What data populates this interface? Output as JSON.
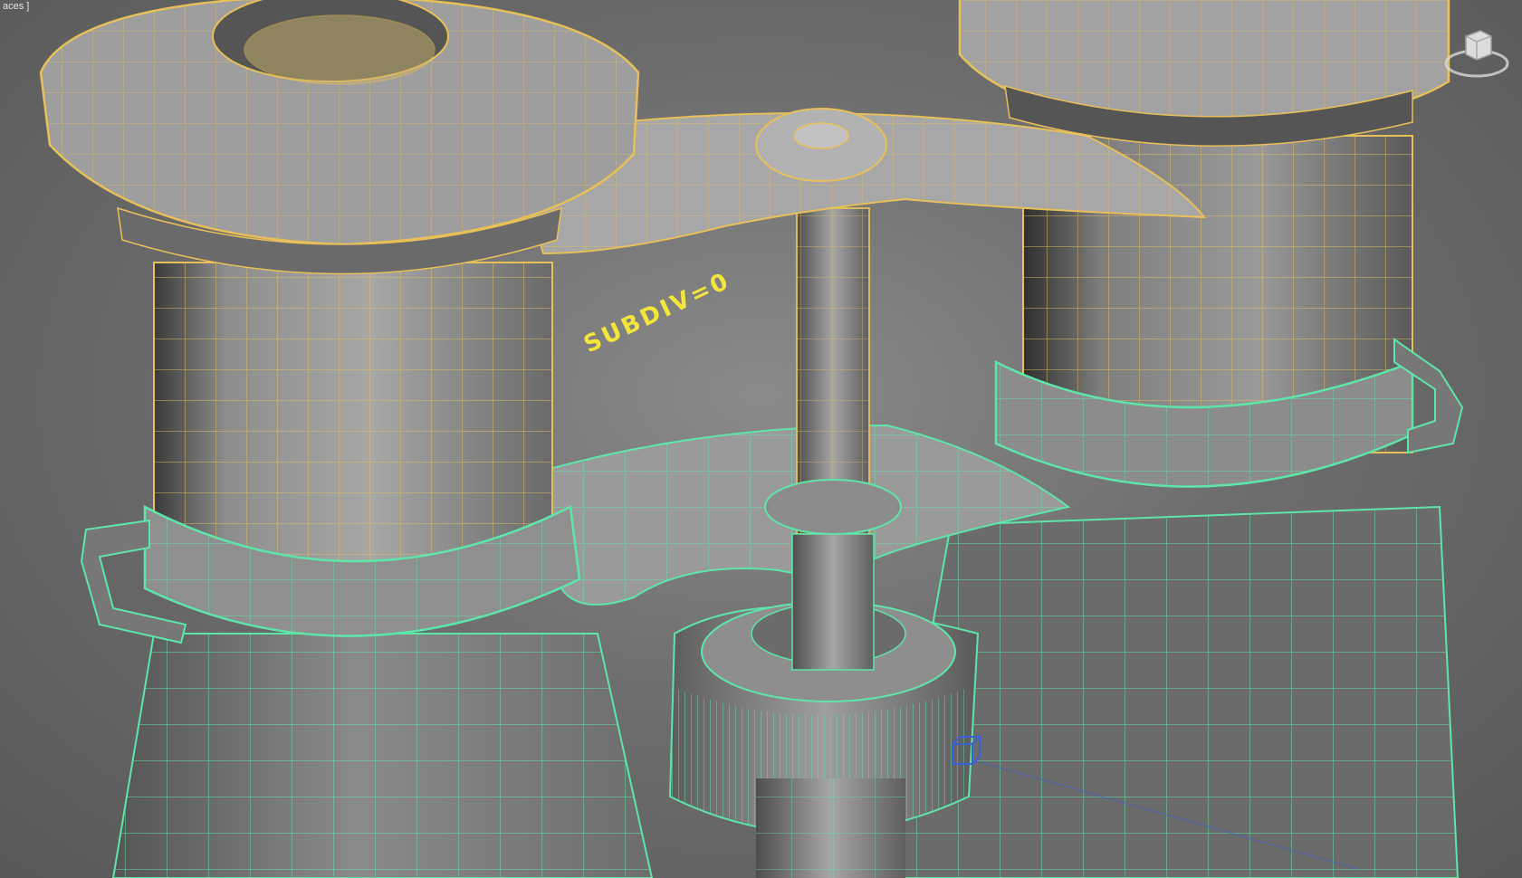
{
  "viewport": {
    "label": "aces ]",
    "annotation": "SUBDIV=0"
  },
  "colors": {
    "background": "#5f5f5f",
    "wire_selected_yellow": "#e8c05a",
    "wire_green": "#5ee6a8",
    "annotation_yellow": "#f3e53a",
    "gizmo_blue": "#3a5fd6"
  },
  "viewcube": {
    "icon": "viewcube-icon"
  }
}
